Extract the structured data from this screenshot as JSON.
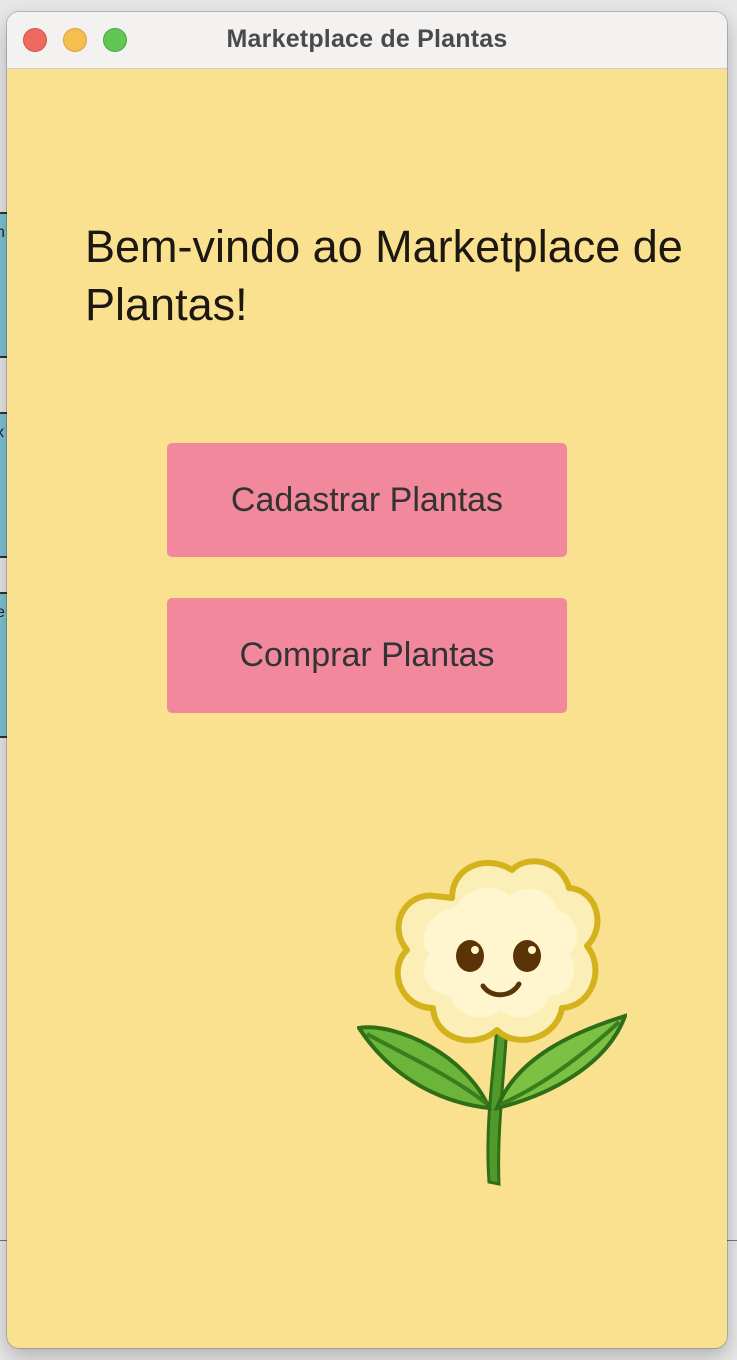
{
  "window": {
    "title": "Marketplace de Plantas"
  },
  "main": {
    "welcome_text": "Bem-vindo ao Marketplace de Plantas!",
    "buttons": {
      "register_label": "Cadastrar Plantas",
      "buy_label": "Comprar Plantas"
    }
  },
  "colors": {
    "background": "#fae190",
    "button": "#f1889b",
    "close": "#ee6a5f",
    "minimize": "#f5be4f",
    "zoom": "#62c655"
  },
  "icons": {
    "illustration": "smiling-flower-icon"
  }
}
